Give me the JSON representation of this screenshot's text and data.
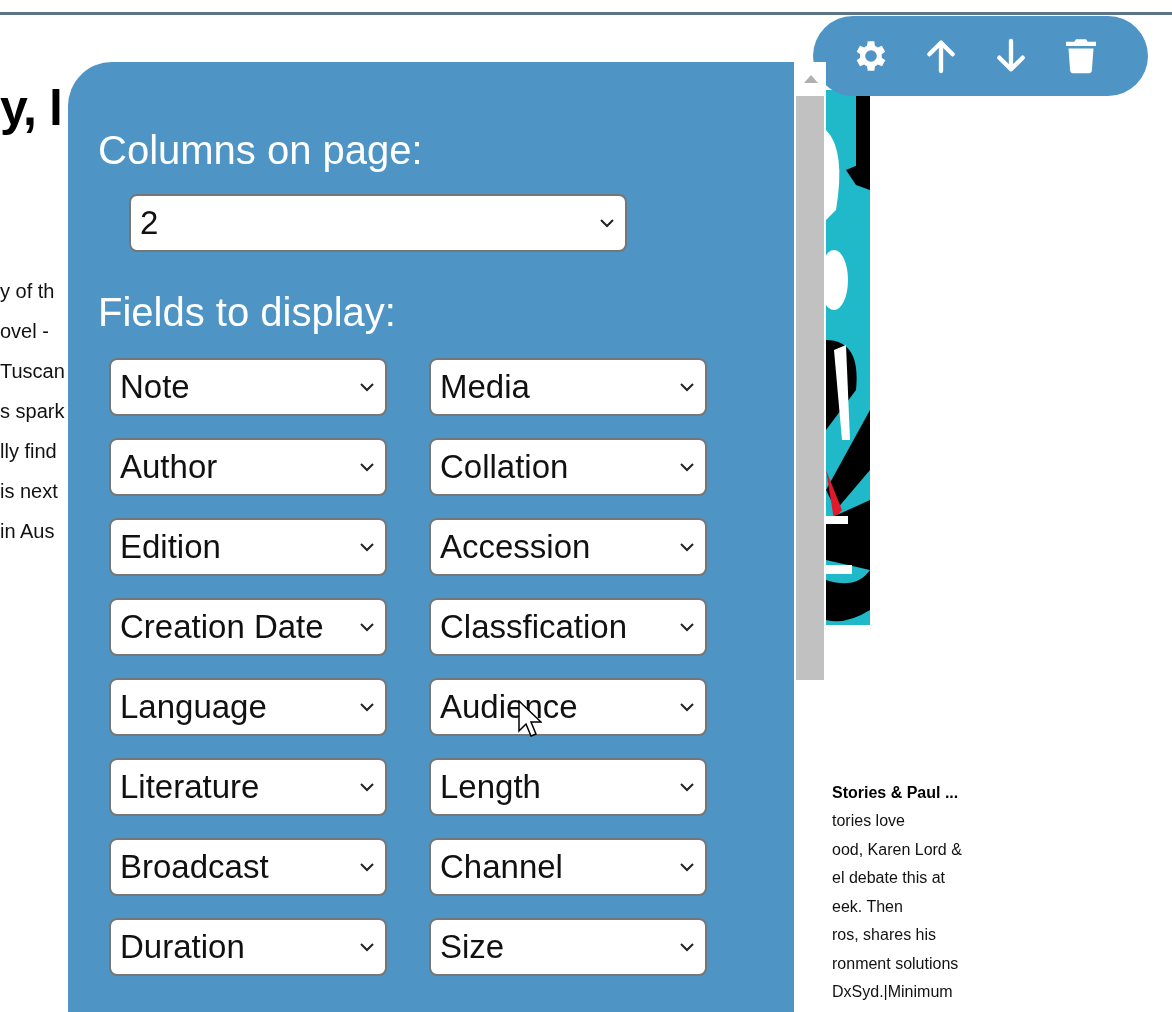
{
  "background_page": {
    "heading": "y, l",
    "left_lines": [
      "y of th",
      "ovel -",
      "Tuscan",
      "s spark",
      "lly find",
      "is next",
      "in Aus"
    ],
    "cover": {
      "kind": "picture"
    },
    "right_title": "Stories & Paul ...",
    "right_lines": [
      "tories love",
      "ood, Karen Lord &",
      "el debate this at",
      "eek. Then",
      "ros, shares his",
      "ronment solutions",
      "DxSyd.|Minimum"
    ]
  },
  "toolbar": {
    "buttons": [
      {
        "kind": "settings"
      },
      {
        "kind": "up"
      },
      {
        "kind": "down"
      },
      {
        "kind": "delete"
      }
    ]
  },
  "settings_panel": {
    "columns_label": "Columns on page:",
    "columns_value": "2",
    "fields_label": "Fields to display:",
    "fields": [
      [
        "Note",
        "Media"
      ],
      [
        "Author",
        "Collation"
      ],
      [
        "Edition",
        "Accession"
      ],
      [
        "Creation Date",
        "Classfication"
      ],
      [
        "Language",
        "Audience"
      ],
      [
        "Literature",
        "Length"
      ],
      [
        "Broadcast",
        "Channel"
      ],
      [
        "Duration",
        "Size"
      ]
    ]
  }
}
